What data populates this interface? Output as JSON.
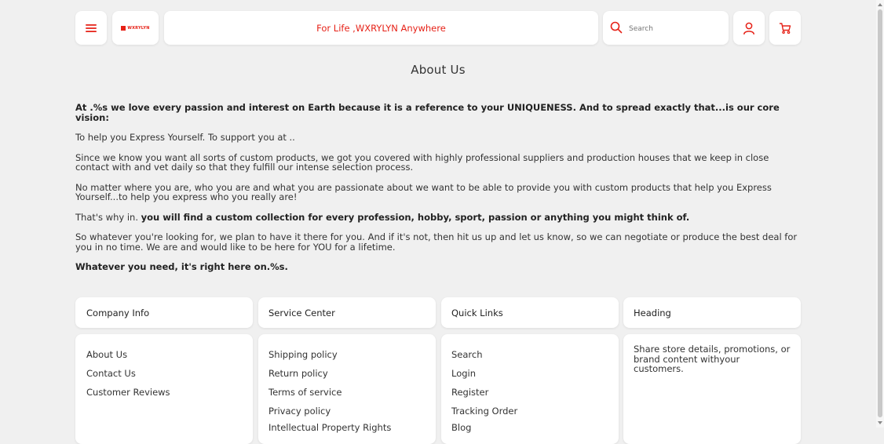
{
  "header": {
    "brand_logo_text": "WXRYLYN",
    "tagline": "For Life ,WXRYLYN Anywhere",
    "search_placeholder": "Search",
    "accent_color": "#e62117"
  },
  "main": {
    "title": "About Us",
    "p1": "At .%s we love every passion and interest on Earth because it is a reference to your UNIQUENESS. And to spread exactly that...is our core vision:",
    "p2": "To help you Express Yourself. To support you at ..",
    "p3": "Since we know you want all sorts of custom products, we got you covered with highly professional suppliers and production houses that we keep in close contact with and vet daily so that they fulfill our intense selection process.",
    "p4": "No matter where you are, who you are and what you are passionate about we want to be able to provide you with custom products that help you Express Yourself...to help you express who you really are!",
    "p5_normal": "That's why in. ",
    "p5_bold": "you will find a custom collection for every profession, hobby, sport, passion or anything you might think of.",
    "p6": "So whatever you're looking for, we plan to have it there for you. And if it's not, then hit us up and let us know, so we can negotiate or produce the best deal for you in no time. We are and would like to be here for YOU for a lifetime.",
    "p7": "Whatever you need, it's right here on.%s."
  },
  "footer": {
    "company_info": {
      "title": "Company Info",
      "links": [
        "About Us",
        "Contact Us",
        "Customer Reviews"
      ]
    },
    "service_center": {
      "title": "Service Center",
      "links": [
        "Shipping policy",
        "Return policy",
        "Terms of service",
        "Privacy policy",
        "Intellectual Property Rights"
      ]
    },
    "quick_links": {
      "title": "Quick Links",
      "links": [
        "Search",
        "Login",
        "Register",
        "Tracking Order",
        "Blog"
      ]
    },
    "heading": {
      "title": "Heading",
      "text": "Share store details, promotions, or brand content withyour customers."
    }
  }
}
